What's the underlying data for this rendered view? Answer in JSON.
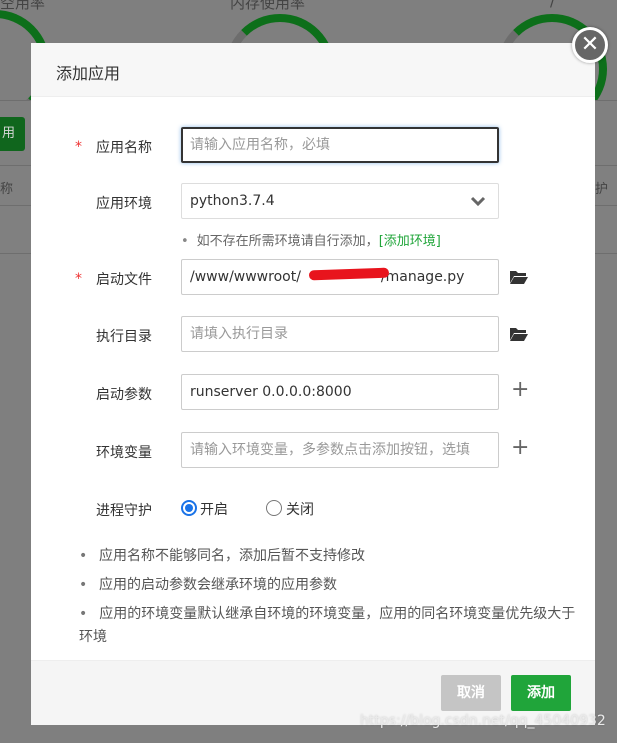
{
  "background": {
    "gauge_labels": [
      "空用率",
      "内存使用率",
      "/"
    ],
    "button_label": "用",
    "col_left": "称",
    "col_right": "护"
  },
  "dialog": {
    "title": "添加应用",
    "close_icon": "close-icon"
  },
  "form": {
    "app_name": {
      "required": "*",
      "label": "应用名称",
      "value": "",
      "placeholder": "请输入应用名称，必填"
    },
    "app_env": {
      "label": "应用环境",
      "value": "python3.7.4",
      "icon": "chevron-down-icon"
    },
    "env_hint": {
      "bullet": "•",
      "text": "如不存在所需环境请自行添加，",
      "link": "[添加环境]"
    },
    "start_file": {
      "required": "*",
      "label": "启动文件",
      "value": "/www/wwwroot/████████/manage.py",
      "value_prefix": "/www/wwwroot/",
      "value_suffix": "/manage.py",
      "icon": "folder-open-icon"
    },
    "exec_dir": {
      "label": "执行目录",
      "value": "",
      "placeholder": "请填入执行目录",
      "icon": "folder-open-icon"
    },
    "start_params": {
      "label": "启动参数",
      "value": "runserver 0.0.0.0:8000",
      "icon": "plus-icon"
    },
    "env_vars": {
      "label": "环境变量",
      "value": "",
      "placeholder": "请输入环境变量，多参数点击添加按钮，选填",
      "icon": "plus-icon"
    },
    "daemon": {
      "label": "进程守护",
      "options": [
        "开启",
        "关闭"
      ],
      "selected": "开启"
    }
  },
  "notes": [
    "应用名称不能够同名，添加后暂不支持修改",
    "应用的启动参数会继承环境的应用参数",
    "应用的环境变量默认继承自环境的环境变量，应用的同名环境变量优先级大于环境"
  ],
  "footer": {
    "cancel_label": "取消",
    "add_label": "添加"
  },
  "watermark": "https://blog.csdn.net/qq_45040932",
  "colors": {
    "accent": "#20a53a",
    "required": "#e33333",
    "radio": "#1a73e8"
  }
}
